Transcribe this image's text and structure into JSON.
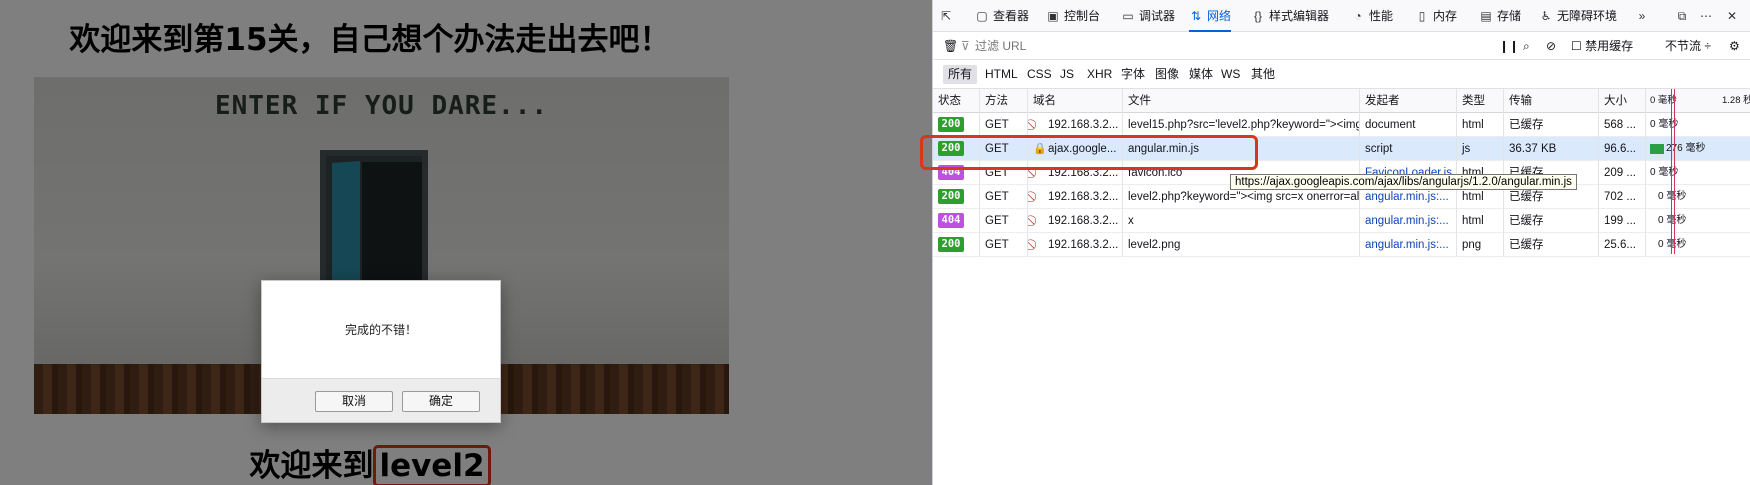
{
  "page": {
    "heading": "欢迎来到第15关，自己想个办法走出去吧！",
    "scene_title": "ENTER IF YOU DARE...",
    "subheading_prefix": "欢迎来到",
    "subheading_level": "level2"
  },
  "dialog": {
    "message": "完成的不错！",
    "cancel_label": "取消",
    "ok_label": "确定"
  },
  "devtools": {
    "tools": [
      {
        "label": "查看器",
        "icon": "inspector-icon"
      },
      {
        "label": "控制台",
        "icon": "console-icon"
      },
      {
        "label": "调试器",
        "icon": "debugger-icon"
      },
      {
        "label": "网络",
        "icon": "network-icon",
        "selected": true
      },
      {
        "label": "样式编辑器",
        "icon": "style-editor-icon"
      },
      {
        "label": "性能",
        "icon": "performance-icon"
      },
      {
        "label": "内存",
        "icon": "memory-icon"
      },
      {
        "label": "存储",
        "icon": "storage-icon"
      },
      {
        "label": "无障碍环境",
        "icon": "accessibility-icon"
      }
    ],
    "filter_placeholder": "过滤 URL",
    "disable_cache_label": "禁用缓存",
    "throttle_label": "不节流 ÷",
    "types": [
      "所有",
      "HTML",
      "CSS",
      "JS",
      "XHR",
      "字体",
      "图像",
      "媒体",
      "WS",
      "其他"
    ],
    "active_type": "所有",
    "columns": [
      "状态",
      "方法",
      "域名",
      "文件",
      "发起者",
      "类型",
      "传输",
      "大小"
    ],
    "waterfall_ticks": [
      "0 毫秒",
      "1.28 秒"
    ],
    "rows": [
      {
        "status": "200",
        "method": "GET",
        "domain": "192.168.3.2...",
        "file": "level15.php?src='level2.php?keyword=\"><img src=",
        "initiator": "document",
        "type": "html",
        "transfer": "已缓存",
        "size": "568 ...",
        "timing": "0 毫秒"
      },
      {
        "status": "200",
        "method": "GET",
        "domain": "ajax.google...",
        "file": "angular.min.js",
        "initiator": "script",
        "type": "js",
        "transfer": "36.37 KB",
        "size": "96.6...",
        "timing": "276 毫秒"
      },
      {
        "status": "404",
        "method": "GET",
        "domain": "192.168.3.2...",
        "file": "favicon.ico",
        "initiator": "FaviconLoader.js...",
        "type": "html",
        "transfer": "已缓存",
        "size": "209 ...",
        "timing": "0 毫秒"
      },
      {
        "status": "200",
        "method": "GET",
        "domain": "192.168.3.2...",
        "file": "level2.php?keyword=\"><img src=x onerror=al",
        "initiator": "angular.min.js:...",
        "type": "html",
        "transfer": "已缓存",
        "size": "702 ...",
        "timing": "0 毫秒"
      },
      {
        "status": "404",
        "method": "GET",
        "domain": "192.168.3.2...",
        "file": "x",
        "initiator": "angular.min.js:...",
        "type": "html",
        "transfer": "已缓存",
        "size": "199 ...",
        "timing": "0 毫秒"
      },
      {
        "status": "200",
        "method": "GET",
        "domain": "192.168.3.2...",
        "file": "level2.png",
        "initiator": "angular.min.js:...",
        "type": "png",
        "transfer": "已缓存",
        "size": "25.6...",
        "timing": "0 毫秒"
      }
    ],
    "tooltip": "https://ajax.googleapis.com/ajax/libs/angularjs/1.2.0/angular.min.js",
    "colors": {
      "ok": "#2ca02c",
      "not_found": "#c050e0",
      "accent": "#0061e0",
      "annotation": "#d9361b"
    }
  }
}
